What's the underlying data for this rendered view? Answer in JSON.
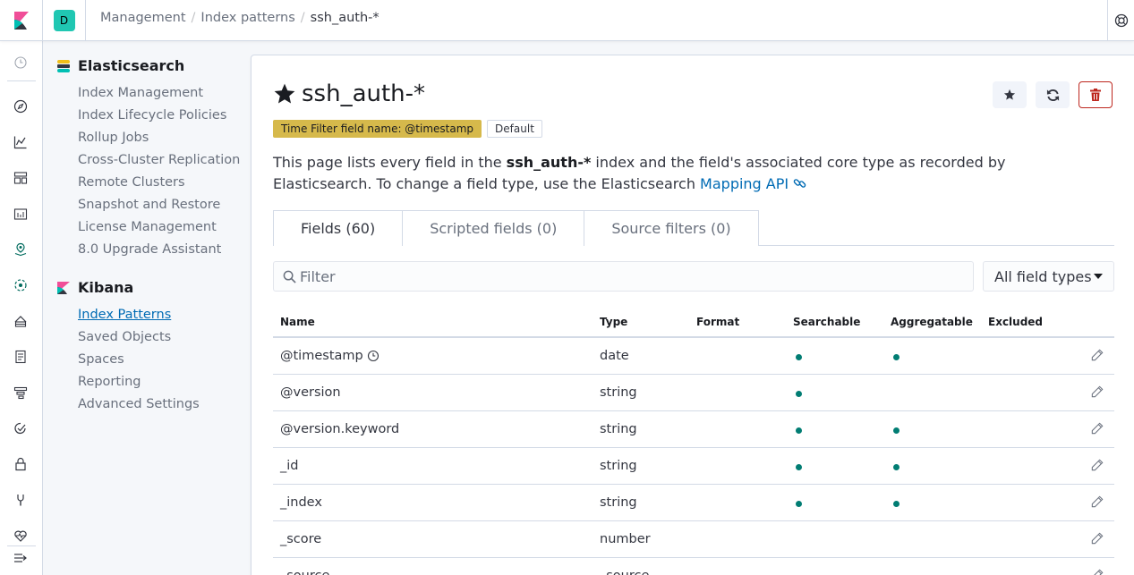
{
  "header": {
    "space_initial": "D",
    "breadcrumbs": [
      "Management",
      "Index patterns",
      "ssh_auth-*"
    ]
  },
  "sidebar": {
    "sections": [
      {
        "title": "Elasticsearch",
        "items": [
          "Index Management",
          "Index Lifecycle Policies",
          "Rollup Jobs",
          "Cross-Cluster Replication",
          "Remote Clusters",
          "Snapshot and Restore",
          "License Management",
          "8.0 Upgrade Assistant"
        ]
      },
      {
        "title": "Kibana",
        "items": [
          "Index Patterns",
          "Saved Objects",
          "Spaces",
          "Reporting",
          "Advanced Settings"
        ],
        "active_index": 0
      }
    ]
  },
  "page": {
    "title": "ssh_auth-*",
    "badges": {
      "time_filter": "Time Filter field name: @timestamp",
      "default": "Default"
    },
    "description": {
      "part1": "This page lists every field in the ",
      "index_name": "ssh_auth-*",
      "part2": " index and the field's associated core type as recorded by Elasticsearch. To change a field type, use the Elasticsearch ",
      "link": "Mapping API"
    },
    "tabs": [
      "Fields (60)",
      "Scripted fields (0)",
      "Source filters (0)"
    ],
    "filter": {
      "placeholder": "Filter"
    },
    "type_select": {
      "value": "All field types"
    },
    "table": {
      "columns": [
        "Name",
        "Type",
        "Format",
        "Searchable",
        "Aggregatable",
        "Excluded"
      ],
      "rows": [
        {
          "name": "@timestamp",
          "type": "date",
          "time_field": true,
          "searchable": true,
          "aggregatable": true
        },
        {
          "name": "@version",
          "type": "string",
          "searchable": true,
          "aggregatable": false
        },
        {
          "name": "@version.keyword",
          "type": "string",
          "searchable": true,
          "aggregatable": true
        },
        {
          "name": "_id",
          "type": "string",
          "searchable": true,
          "aggregatable": true
        },
        {
          "name": "_index",
          "type": "string",
          "searchable": true,
          "aggregatable": true
        },
        {
          "name": "_score",
          "type": "number",
          "searchable": false,
          "aggregatable": false
        },
        {
          "name": "_source",
          "type": "_source",
          "searchable": false,
          "aggregatable": false
        }
      ]
    }
  },
  "colors": {
    "accent": "#006bb4",
    "dot": "#017d73",
    "danger": "#bd271e",
    "badge_time": "#d6b94b"
  }
}
